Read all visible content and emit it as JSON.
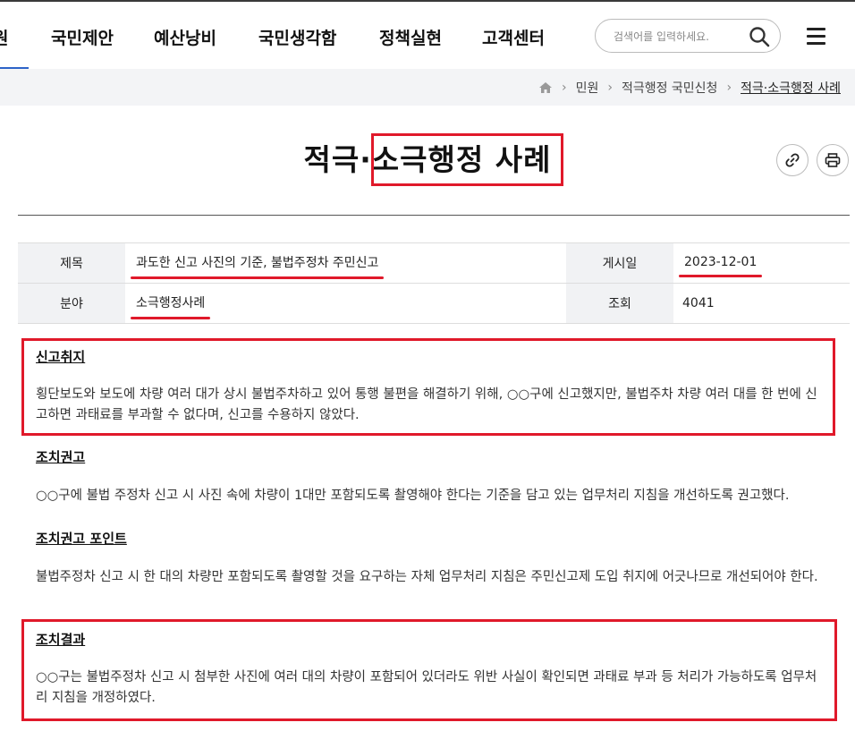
{
  "nav": {
    "items": [
      "원",
      "국민제안",
      "예산낭비",
      "국민생각함",
      "정책실현",
      "고객센터"
    ],
    "search_placeholder": "검색어를 입력하세요.",
    "search_icon": "search-icon",
    "menu_icon": "hamburger-icon",
    "accent": "#2d64c8"
  },
  "breadcrumb": {
    "home_icon": "home-icon",
    "items": [
      "민원",
      "적극행정 국민신청",
      "적극·소극행정 사례"
    ]
  },
  "page": {
    "title": "적극·소극행정 사례",
    "share_icon": "link-icon",
    "print_icon": "print-icon"
  },
  "info": {
    "title_label": "제목",
    "title_value": "과도한 신고 사진의 기준, 불법주정차 주민신고",
    "date_label": "게시일",
    "date_value": "2023-12-01",
    "field_label": "분야",
    "field_value": "소극행정사례",
    "views_label": "조회",
    "views_value": "4041"
  },
  "sections": [
    {
      "heading": "신고취지",
      "body": "횡단보도와 보도에 차량 여러 대가 상시 불법주차하고 있어 통행 불편을 해결하기 위해, ○○구에 신고했지만, 불법주차 차량 여러 대를 한 번에 신고하면 과태료를 부과할 수 없다며, 신고를 수용하지 않았다."
    },
    {
      "heading": "조치권고",
      "body": "○○구에 불법 주정차 신고 시 사진 속에 차량이 1대만 포함되도록 촬영해야 한다는 기준을 담고 있는 업무처리 지침을 개선하도록 권고했다."
    },
    {
      "heading": "조치권고 포인트",
      "body": "불법주정차 신고 시 한 대의 차량만 포함되도록 촬영할 것을 요구하는 자체 업무처리 지침은 주민신고제 도입 취지에 어긋나므로 개선되어야 한다."
    },
    {
      "heading": "조치결과",
      "body": "○○구는 불법주정차 신고 시 첨부한 사진에 여러 대의 차량이 포함되어 있더라도 위반 사실이 확인되면 과태료 부과 등 처리가 가능하도록 업무처리 지침을 개정하였다."
    }
  ],
  "highlight_color": "#e0192a"
}
